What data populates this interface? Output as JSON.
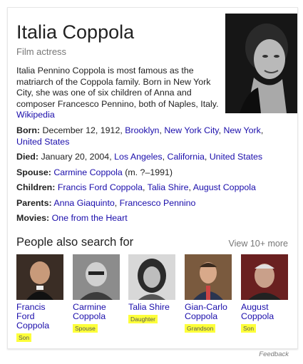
{
  "header": {
    "title": "Italia Coppola",
    "subtitle": "Film actress"
  },
  "description": {
    "text": "Italia Pennino Coppola is most famous as the matriarch of the Coppola family. Born in New York City, she was one of six children of Anna and composer Francesco Pennino, both of Naples, Italy.",
    "source_link": "Wikipedia"
  },
  "facts": {
    "born": {
      "label": "Born:",
      "date": "December 12, 1912,",
      "place1": "Brooklyn",
      "place2": "New York City",
      "place3": "New York",
      "place4": "United States"
    },
    "died": {
      "label": "Died:",
      "date": "January 20, 2004,",
      "place1": "Los Angeles",
      "place2": "California",
      "place3": "United States"
    },
    "spouse": {
      "label": "Spouse:",
      "name": "Carmine Coppola",
      "note": "(m. ?–1991)"
    },
    "children": {
      "label": "Children:",
      "c1": "Francis Ford Coppola",
      "c2": "Talia Shire",
      "c3": "August Coppola"
    },
    "parents": {
      "label": "Parents:",
      "p1": "Anna Giaquinto",
      "p2": "Francesco Pennino"
    },
    "movies": {
      "label": "Movies:",
      "m1": "One from the Heart"
    }
  },
  "people_also_search": {
    "title": "People also search for",
    "view_more": "View 10+ more",
    "people": [
      {
        "name_line1": "Francis",
        "name_line2": "Ford",
        "name_line3": "Coppola",
        "relation": "Son"
      },
      {
        "name_line1": "Carmine",
        "name_line2": "Coppola",
        "relation": "Spouse"
      },
      {
        "name_line1": "Talia Shire",
        "relation": "Daughter"
      },
      {
        "name_line1": "Gian-Carlo",
        "name_line2": "Coppola",
        "relation": "Grandson"
      },
      {
        "name_line1": "August",
        "name_line2": "Coppola",
        "relation": "Son"
      }
    ]
  },
  "footer": {
    "feedback": "Feedback"
  },
  "colors": {
    "link": "#1a0dab",
    "highlight": "#fdff3a",
    "muted": "#777777"
  }
}
